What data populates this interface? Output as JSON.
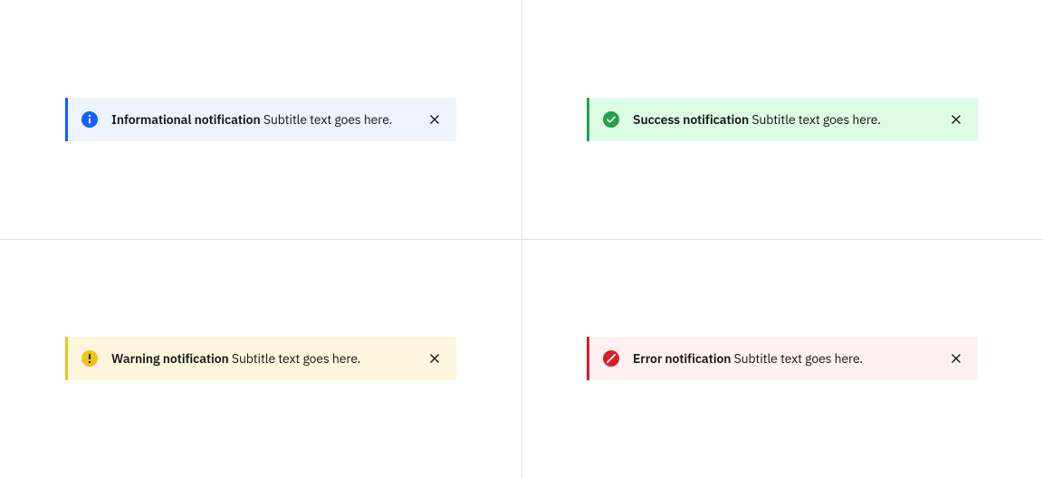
{
  "notifications": {
    "info": {
      "title": "Informational notification",
      "subtitle": "Subtitle text goes here.",
      "accent_color": "#0f62fe",
      "background_color": "#edf4ff",
      "icon": "info-filled"
    },
    "success": {
      "title": "Success notification",
      "subtitle": "Subtitle text goes here.",
      "accent_color": "#24a148",
      "background_color": "#defbe6",
      "icon": "checkmark-filled"
    },
    "warning": {
      "title": "Warning notification",
      "subtitle": "Subtitle text goes here.",
      "accent_color": "#f1c21b",
      "background_color": "#fdf6dd",
      "icon": "warning-filled"
    },
    "error": {
      "title": "Error notification",
      "subtitle": "Subtitle text goes here.",
      "accent_color": "#da1e28",
      "background_color": "#fff1f1",
      "icon": "error-filled"
    }
  }
}
